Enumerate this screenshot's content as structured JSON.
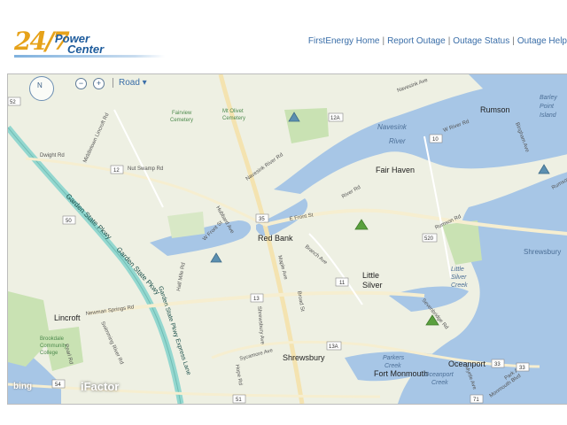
{
  "logo": {
    "num": "24/7",
    "line1": "Power",
    "line2": "Center"
  },
  "nav": {
    "links": [
      "FirstEnergy Home",
      "Report Outage",
      "Outage Status",
      "Outage Help"
    ],
    "sep": "|"
  },
  "map": {
    "compass_label": "N",
    "zoom_out": "−",
    "zoom_in": "+",
    "style_label": "Road ▾",
    "attribution_bing": "bing",
    "attribution_ifactor": "iFactor",
    "places": {
      "red_bank": "Red Bank",
      "fair_haven": "Fair Haven",
      "rumson": "Rumson",
      "little_silver_1": "Little",
      "little_silver_2": "Silver",
      "shrewsbury": "Shrewsbury",
      "shrewsbury_r": "Shrewsbury",
      "lincroft": "Lincroft",
      "oceanport": "Oceanport",
      "fort_monmouth": "Fort Monmouth",
      "navesink_river_1": "Navesink",
      "navesink_river_2": "River",
      "barley_1": "Barley",
      "barley_2": "Point",
      "barley_3": "Island",
      "fairview_1": "Fairview",
      "fairview_2": "Cemetery",
      "olivet_1": "Mt Olivet",
      "olivet_2": "Cemetery",
      "brookdale_1": "Brookdale",
      "brookdale_2": "Community",
      "brookdale_3": "College",
      "ls_creek_1": "Little",
      "ls_creek_2": "Silver",
      "ls_creek_3": "Creek",
      "parkers_1": "Parkers",
      "parkers_2": "Creek",
      "op_creek_1": "Oceanport",
      "op_creek_2": "Creek"
    },
    "roads": {
      "gsp": "Garden State Pkwy",
      "gsp2": "Garden State Pkwy",
      "gsp_express": "Garden State Pkwy Express Lane",
      "dwight": "Dwight Rd",
      "middletown_lincroft": "Middletown Lincroft Rd",
      "nut_swamp": "Nut Swamp Rd",
      "navesink_river_rd": "Navesink River Rd",
      "hubbard": "Hubbard Ave",
      "w_front": "W Front St",
      "e_front": "E Front St",
      "river_rd": "River Rd",
      "w_river_rd": "W River Rd",
      "rumson_rd": "Rumson Rd",
      "bingham": "Bingham Ave",
      "navesink_ave": "Navesink Ave",
      "branch": "Branch Ave",
      "maple": "Maple Ave",
      "broad": "Broad St",
      "half_mile": "Half Mile Rd",
      "newman": "Newman Springs Rd",
      "swimming": "Swimming River Rd",
      "shrewsbury_ave": "Shrewsbury Ave",
      "sycamore": "Sycamore Ave",
      "hope": "Hope Rd",
      "sevenbridge": "Sevenbridge Rd",
      "monmouth": "Monmouth Blvd",
      "pearl": "Pearl Rd",
      "myrtle": "Myrtle Ave",
      "park": "Park Ave",
      "rumson_far": "Rumson Rd"
    },
    "shields": [
      "52",
      "12A",
      "10",
      "12",
      "35",
      "50",
      "520",
      "11",
      "13",
      "13A",
      "33",
      "33",
      "54",
      "51",
      "71"
    ],
    "marker_colors": {
      "blue": "#5b8fb0",
      "green": "#5aa03e"
    },
    "water_color": "#a7c6e6",
    "land_color": "#eef0e3",
    "park_color": "#c9e2b3",
    "parkway_color": "#93d7cf"
  }
}
